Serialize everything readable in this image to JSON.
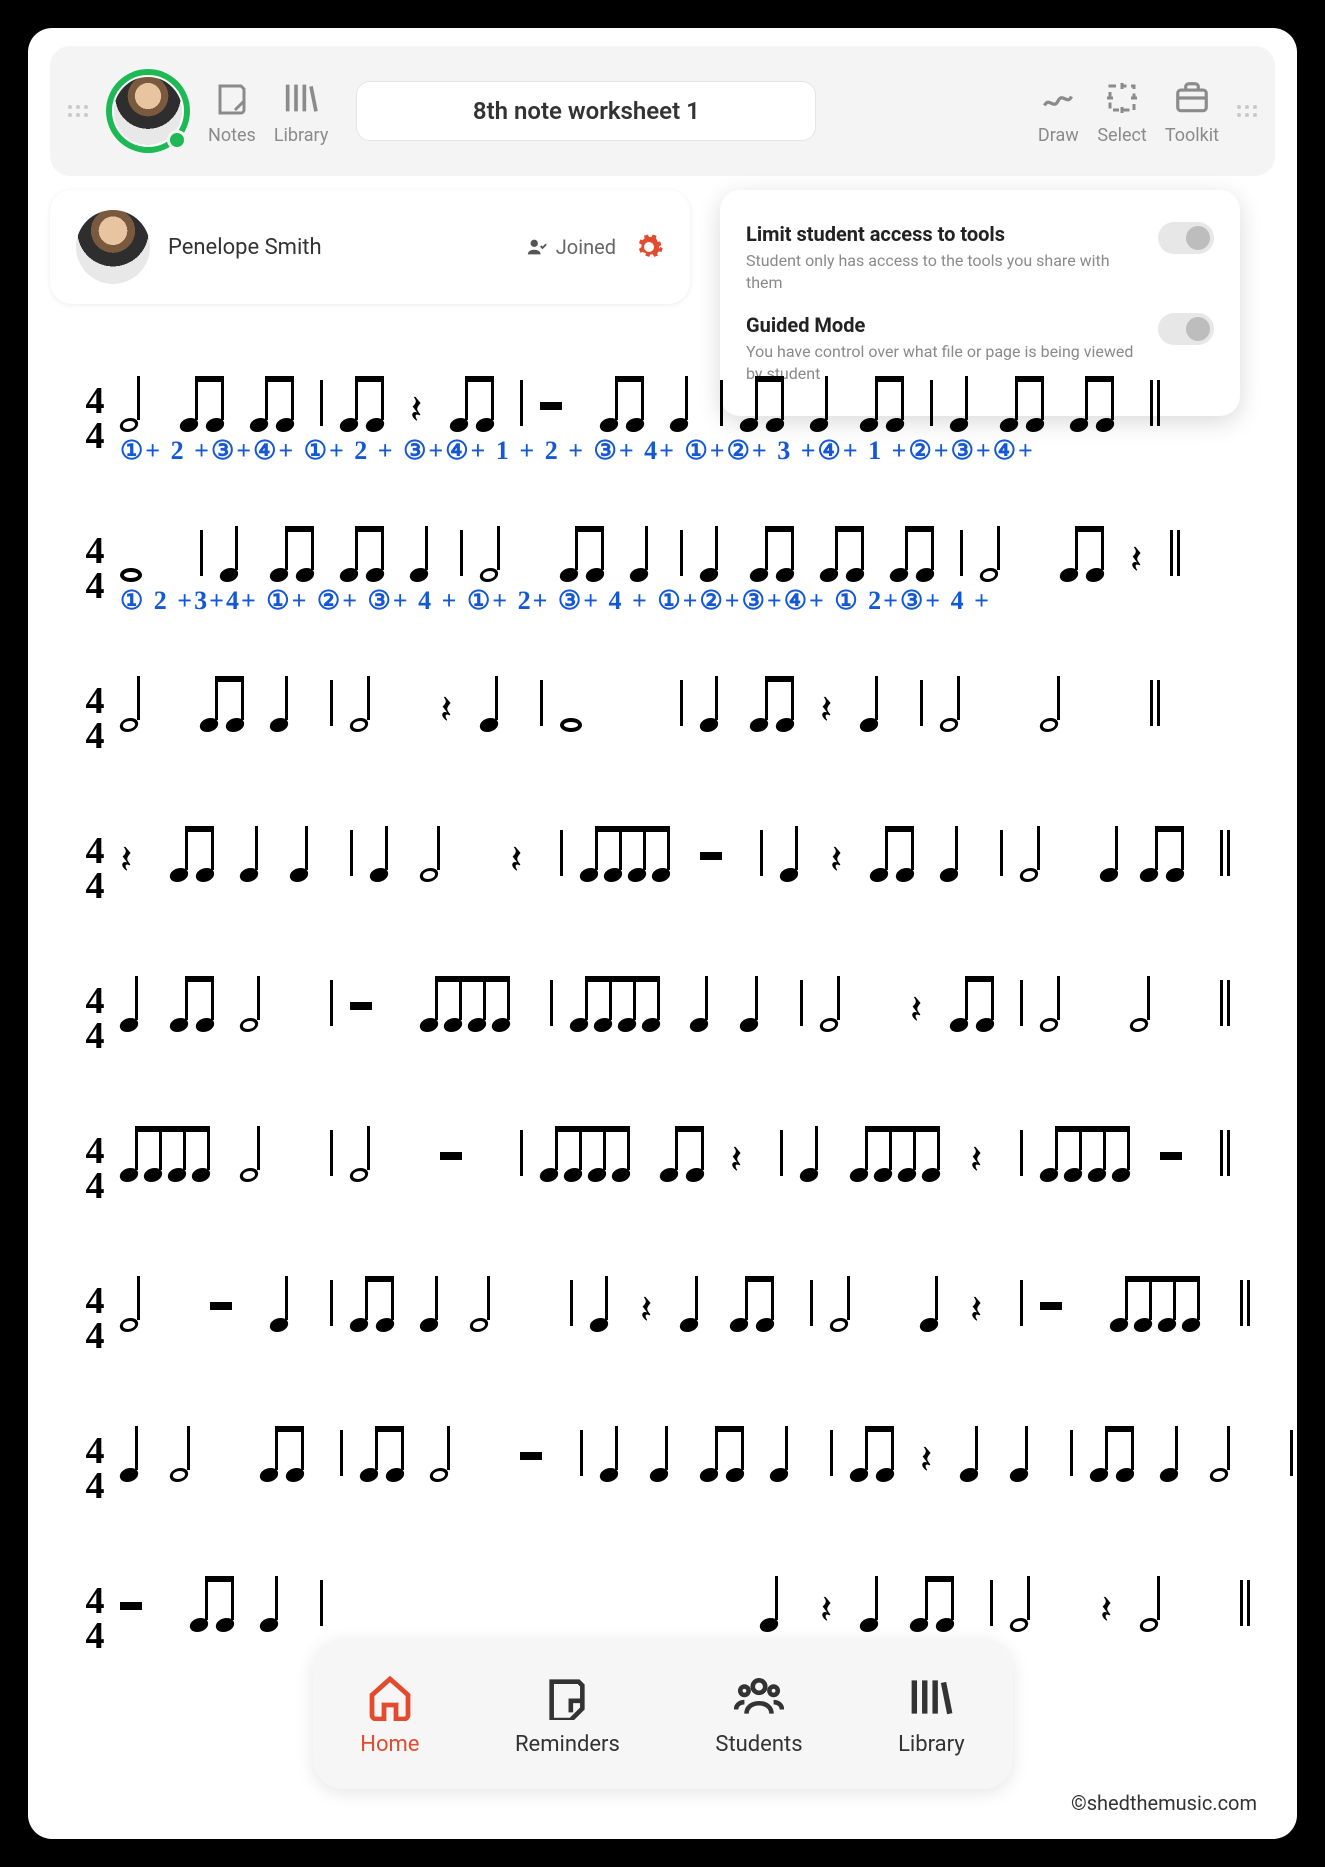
{
  "toolbar": {
    "notes_label": "Notes",
    "library_label": "Library",
    "title": "8th note worksheet 1",
    "draw_label": "Draw",
    "select_label": "Select",
    "toolkit_label": "Toolkit"
  },
  "student": {
    "name": "Penelope Smith",
    "status": "Joined"
  },
  "popover": {
    "limit_title": "Limit student access to tools",
    "limit_desc": "Student only has access to the tools you share with them",
    "guided_title": "Guided Mode",
    "guided_desc": "You have control over what file or page is being viewed by student",
    "limit_enabled": false,
    "guided_enabled": false
  },
  "worksheet": {
    "time_signature_top": "4",
    "time_signature_bottom": "4",
    "row_count": 9,
    "handwriting": {
      "row1": "①+ 2 +③+④+  ①+ 2 + ③+④+   1 + 2 + ③+ 4+   ①+②+ 3 +④+   1 +②+③+④+",
      "row2": "① 2 +3+4+  ①+ ②+  ③+ 4 +   ①+  2+  ③+ 4 +   ①+②+③+④+   ① 2+③+ 4 +"
    },
    "copyright": "©shedthemusic.com"
  },
  "bottom_nav": {
    "home": "Home",
    "reminders": "Reminders",
    "students": "Students",
    "library": "Library",
    "active": "home"
  }
}
